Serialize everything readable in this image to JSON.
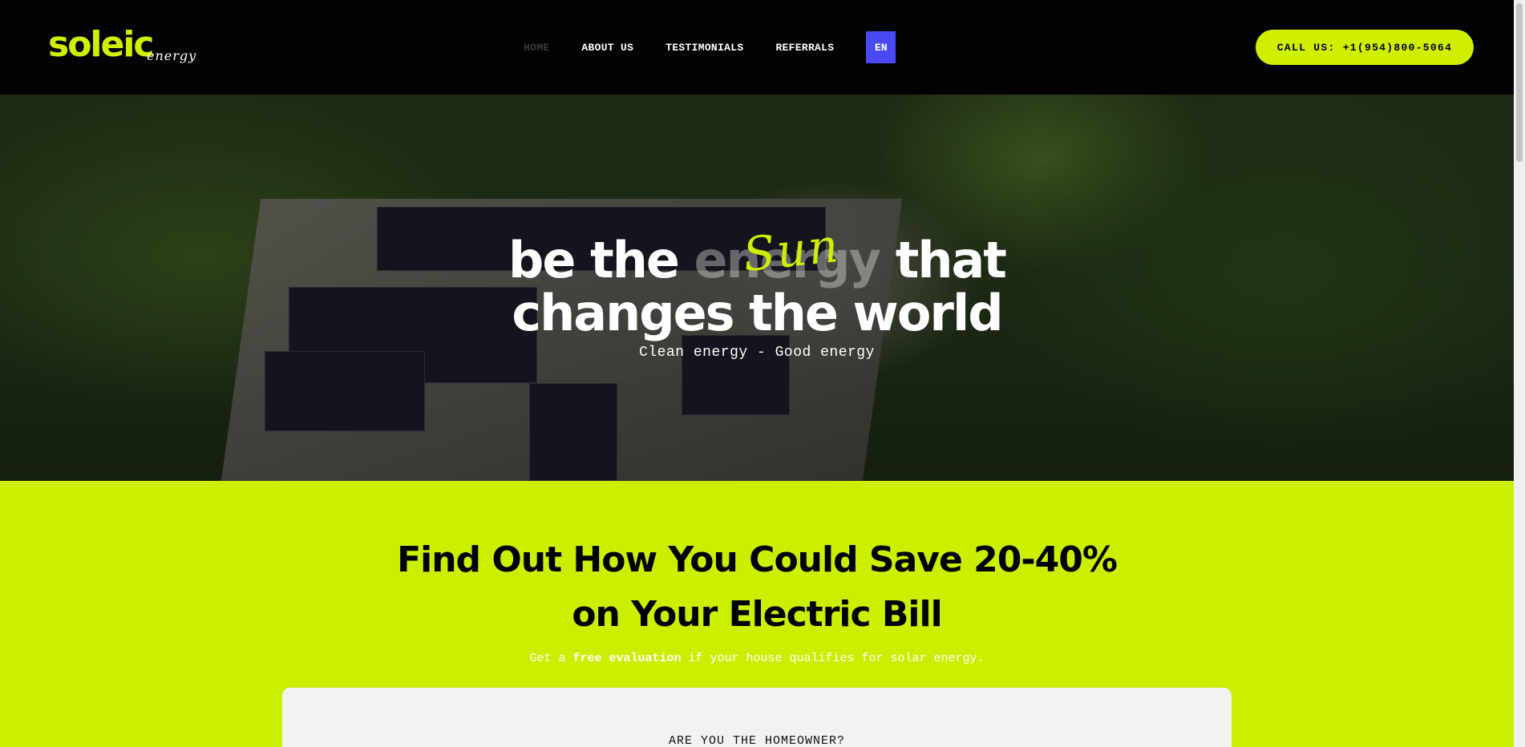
{
  "header": {
    "logo_main": "soleic",
    "logo_sub": "energy",
    "nav": [
      {
        "label": "HOME",
        "active": true
      },
      {
        "label": "ABOUT US",
        "active": false
      },
      {
        "label": "TESTIMONIALS",
        "active": false
      },
      {
        "label": "REFERRALS",
        "active": false
      }
    ],
    "lang": "EN",
    "call_label": "CALL US: +1(954)800-5064"
  },
  "hero": {
    "line1_a": "be the ",
    "line1_struck": "energy",
    "line1_script": "Sun",
    "line1_b": " that",
    "line2": "changes the world",
    "subtitle": "Clean energy - Good energy"
  },
  "savings": {
    "title_line1": "Find Out How You Could Save 20-40%",
    "title_line2": "on Your Electric Bill",
    "sub_prefix": "Get a ",
    "sub_bold": "free evaluation",
    "sub_suffix": " if your house qualifies for solar energy.",
    "question": "ARE YOU THE HOMEOWNER?"
  },
  "colors": {
    "accent": "#d0ee00",
    "lang_button": "#4a4af5",
    "header_bg": "#030303"
  }
}
